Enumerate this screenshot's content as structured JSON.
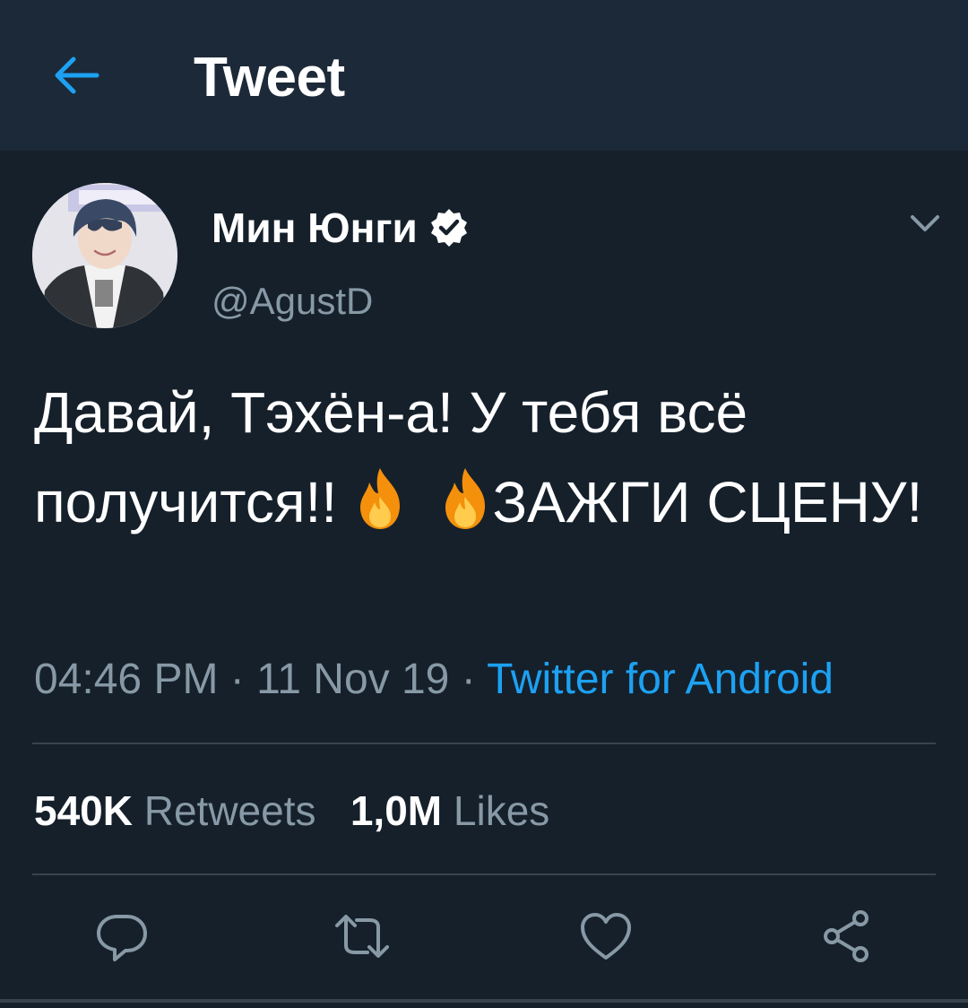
{
  "header": {
    "title": "Tweet",
    "back_icon": "arrow-left-icon"
  },
  "tweet": {
    "display_name": "Мин Юнги",
    "handle": "@AgustD",
    "text_part1": "Давай, Тэхён-а! У тебя всё получится!! ",
    "text_part2": "ЗАЖГИ СЦЕНУ!",
    "emoji": "fire-icon",
    "time": "04:46 PM",
    "separator": " · ",
    "date": "11 Nov 19",
    "source": "Twitter for Android"
  },
  "stats": {
    "retweets_count": "540K",
    "retweets_label": "Retweets",
    "likes_count": "1,0M",
    "likes_label": "Likes"
  },
  "actions": {
    "reply_icon": "reply-icon",
    "retweet_icon": "retweet-icon",
    "like_icon": "heart-icon",
    "share_icon": "share-icon"
  },
  "colors": {
    "background": "#15202b",
    "header_background": "#1c2938",
    "accent": "#1da1f2",
    "secondary_text": "#8899a6",
    "divider": "#38444d"
  }
}
